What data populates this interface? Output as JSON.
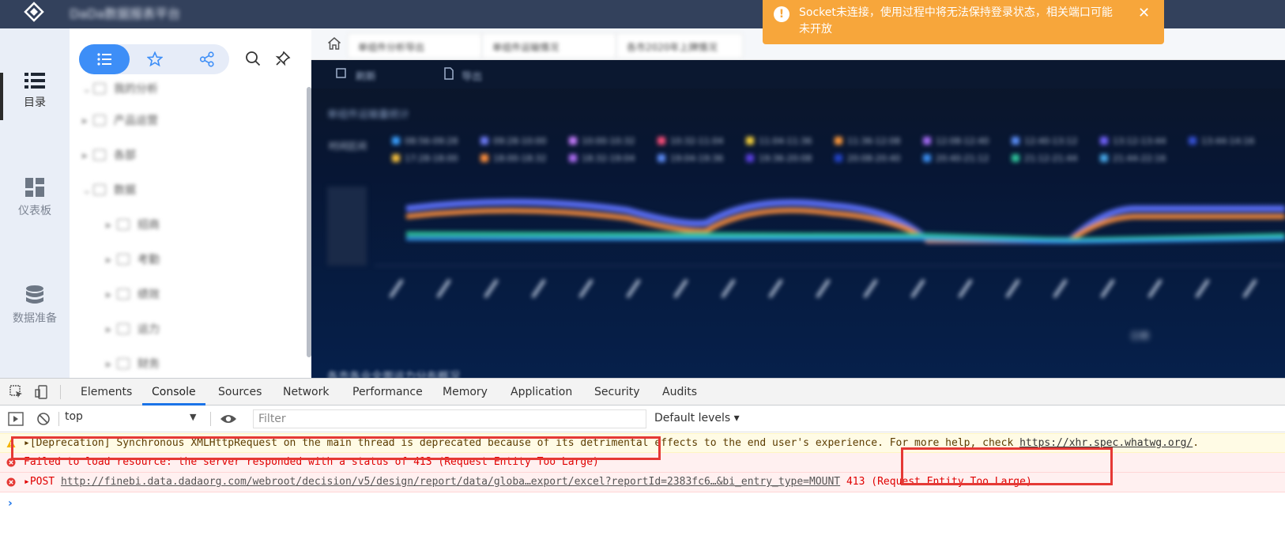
{
  "app": {
    "title": "DaDa数据报表平台"
  },
  "toast": {
    "text": "Socket未连接，使用过程中将无法保持登录状态，相关端口可能未开放",
    "icon": "warning-circle-icon",
    "close_icon": "close-icon",
    "color": "#f7a63b"
  },
  "rail": {
    "items": [
      {
        "label": "目录",
        "icon": "list-icon",
        "active": true
      },
      {
        "label": "仪表板",
        "icon": "dashboard-icon",
        "active": false
      },
      {
        "label": "数据准备",
        "icon": "database-icon",
        "active": false
      }
    ]
  },
  "directory": {
    "segments": [
      "list-icon",
      "star-icon",
      "share-icon"
    ],
    "tools": [
      "search-icon",
      "pin-icon"
    ],
    "tree": [
      {
        "label": "我的分析",
        "level": 0
      },
      {
        "label": "产品运营",
        "level": 0
      },
      {
        "label": "各部",
        "level": 0
      },
      {
        "label": "数据",
        "level": 0
      },
      {
        "label": "招商",
        "level": 1
      },
      {
        "label": "考勤",
        "level": 1
      },
      {
        "label": "绩效",
        "level": 1
      },
      {
        "label": "运力",
        "level": 1
      },
      {
        "label": "财务",
        "level": 1
      }
    ]
  },
  "main": {
    "tabs": [
      "单组件分析导出",
      "单组件运输情况",
      "各市2020年上牌情况"
    ],
    "toolbar": [
      "刷新",
      "导出"
    ],
    "chart_title": "单组件运输量统计",
    "legend_title": "时间区间",
    "legend": [
      {
        "label": "08:56-09:28",
        "color": "#3aa0ff"
      },
      {
        "label": "09:28-10:00",
        "color": "#6f7cf7"
      },
      {
        "label": "10:00-10:32",
        "color": "#c77dff"
      },
      {
        "label": "10:32-11:04",
        "color": "#ff4f7b"
      },
      {
        "label": "11:04-11:36",
        "color": "#f8d33c"
      },
      {
        "label": "11:36-12:08",
        "color": "#ff9a3c"
      },
      {
        "label": "12:08-12:40",
        "color": "#a56bf5"
      },
      {
        "label": "12:40-13:12",
        "color": "#5b8ff9"
      },
      {
        "label": "13:12-13:44",
        "color": "#7262fd"
      },
      {
        "label": "13:44-14:16",
        "color": "#3651d4"
      },
      {
        "label": "17:28-18:00",
        "color": "#f8c13c"
      },
      {
        "label": "18:00-18:32",
        "color": "#ff8f3c"
      },
      {
        "label": "18:32-19:04",
        "color": "#b06ef5"
      },
      {
        "label": "19:04-19:36",
        "color": "#5d8cf7"
      },
      {
        "label": "19:36-20:08",
        "color": "#5a3fe0"
      },
      {
        "label": "20:08-20:40",
        "color": "#2343c8"
      },
      {
        "label": "20:40-21:12",
        "color": "#3b8ef0"
      },
      {
        "label": "21:12-21:44",
        "color": "#2ec39a"
      },
      {
        "label": "21:44-22:16",
        "color": "#48a9ea"
      }
    ],
    "x_axis_label": "日期",
    "bottom_text": "各市各业全面运力分布概况"
  },
  "devtools": {
    "tabs": [
      "Elements",
      "Console",
      "Sources",
      "Network",
      "Performance",
      "Memory",
      "Application",
      "Security",
      "Audits"
    ],
    "active_tab": "Console",
    "context": "top",
    "filter_placeholder": "Filter",
    "levels": "Default levels",
    "messages": {
      "warn_prefix": "▸[Deprecation] Synchronous XMLHttpRequest on the main thread is deprecated because of its detrimental effects to the end user's experience. For more help, check ",
      "warn_url": "https://xhr.spec.whatwg.org/",
      "warn_suffix": ".",
      "err1": "Failed to load resource: the server responded with a status of 413 (Request Entity Too Large)",
      "err2_prefix": "▸POST ",
      "err2_url": "http://finebi.data.dadaorg.com/webroot/decision/v5/design/report/data/globa…export/excel?reportId=2383fc6…&bi_entry_type=MOUNT",
      "err2_status": " 413 (Request Entity Too Large)"
    },
    "prompt": "›"
  }
}
